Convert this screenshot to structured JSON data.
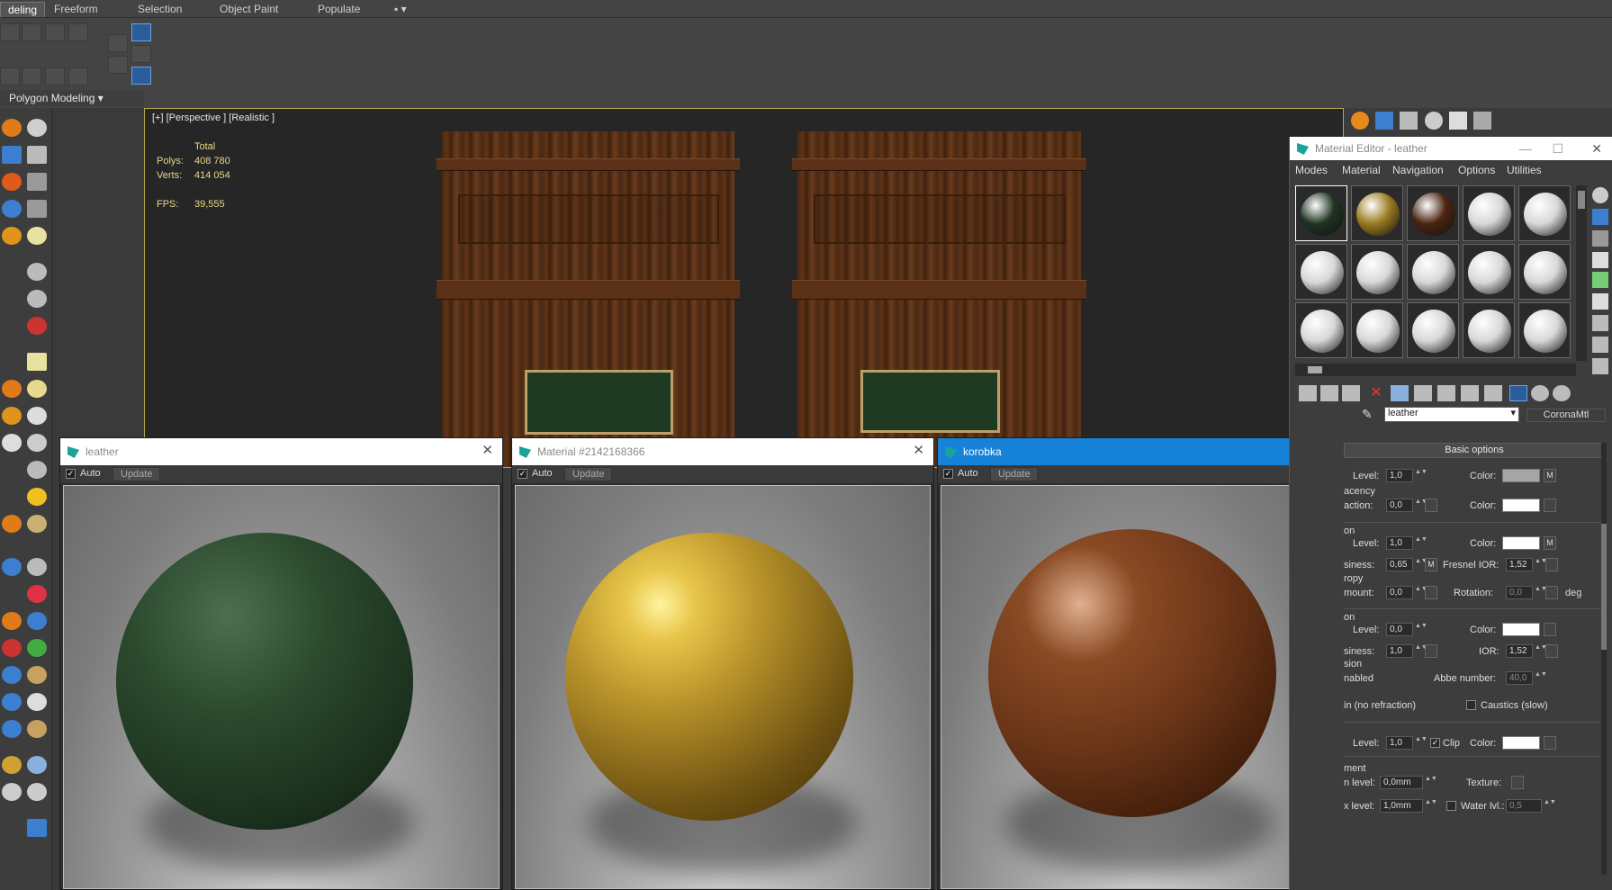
{
  "ribbon": {
    "tabs": [
      "deling",
      "Freeform",
      "Selection",
      "Object Paint",
      "Populate"
    ],
    "active_tab": "deling",
    "panel_label": "Polygon Modeling"
  },
  "viewport": {
    "label": "[+] [Perspective ] [Realistic ]",
    "stats": {
      "total_label": "Total",
      "polys_label": "Polys:",
      "polys_value": "408 780",
      "verts_label": "Verts:",
      "verts_value": "414 054",
      "fps_label": "FPS:",
      "fps_value": "39,555"
    }
  },
  "preview_windows": [
    {
      "title": "leather",
      "auto_label": "Auto",
      "update_label": "Update",
      "active": false,
      "sphere_color": "#2c4a2e"
    },
    {
      "title": "Material #2142168366",
      "auto_label": "Auto",
      "update_label": "Update",
      "active": false,
      "sphere_color": "#c9a53a"
    },
    {
      "title": "korobka",
      "auto_label": "Auto",
      "update_label": "Update",
      "active": true,
      "sphere_color": "#6b3518"
    }
  ],
  "material_editor": {
    "title": "Material Editor - leather",
    "menus": [
      "Modes",
      "Material",
      "Navigation",
      "Options",
      "Utilities"
    ],
    "material_name": "leather",
    "material_type": "CoronaMtl",
    "rollout": "Basic options",
    "slot_colors": [
      "#1f3322",
      "#9a7a20",
      "#4a2410",
      "#d8d8d8",
      "#d8d8d8",
      "#d8d8d8",
      "#d8d8d8",
      "#d8d8d8",
      "#d8d8d8",
      "#d8d8d8",
      "#d8d8d8",
      "#d8d8d8",
      "#d8d8d8",
      "#d8d8d8",
      "#d8d8d8"
    ],
    "params": {
      "diffuse_level_label": "Level:",
      "diffuse_level": "1,0",
      "diffuse_color_label": "Color:",
      "translucency_label": "acency",
      "translucency_fraction_label": "action:",
      "translucency_fraction": "0,0",
      "translucency_color_label": "Color:",
      "reflection_label": "on",
      "refl_level_label": "Level:",
      "refl_level": "1,0",
      "refl_color_label": "Color:",
      "glossiness_label": "siness:",
      "glossiness": "0,65",
      "fresnel_label": "Fresnel IOR:",
      "fresnel": "1,52",
      "anisotropy_label": "ropy",
      "aniso_amount_label": "mount:",
      "aniso_amount": "0,0",
      "rotation_label": "Rotation:",
      "rotation": "0,0",
      "rotation_unit": "deg",
      "refraction_label": "on",
      "refr_level_label": "Level:",
      "refr_level": "0,0",
      "refr_color_label": "Color:",
      "refr_gloss_label": "siness:",
      "refr_gloss": "1,0",
      "ior_label": "IOR:",
      "ior": "1,52",
      "dispersion_label": "sion",
      "enabled_label": "nabled",
      "abbe_label": "Abbe number:",
      "abbe": "40,0",
      "thin_label": "in (no refraction)",
      "caustics_label": "Caustics (slow)",
      "opacity_level_label": "Level:",
      "opacity_level": "1,0",
      "clip_label": "Clip",
      "opacity_color_label": "Color:",
      "displacement_label": "ment",
      "min_level_label": "n level:",
      "min_level": "0,0mm",
      "texture_label": "Texture:",
      "max_level_label": "x level:",
      "max_level": "1,0mm",
      "water_label": "Water lvl.:",
      "water": "0,5",
      "m_label": "M"
    }
  },
  "colors": {
    "accent_blue": "#1683d8",
    "viewport_border": "#b9a64a",
    "stat_text": "#e8d98a"
  }
}
